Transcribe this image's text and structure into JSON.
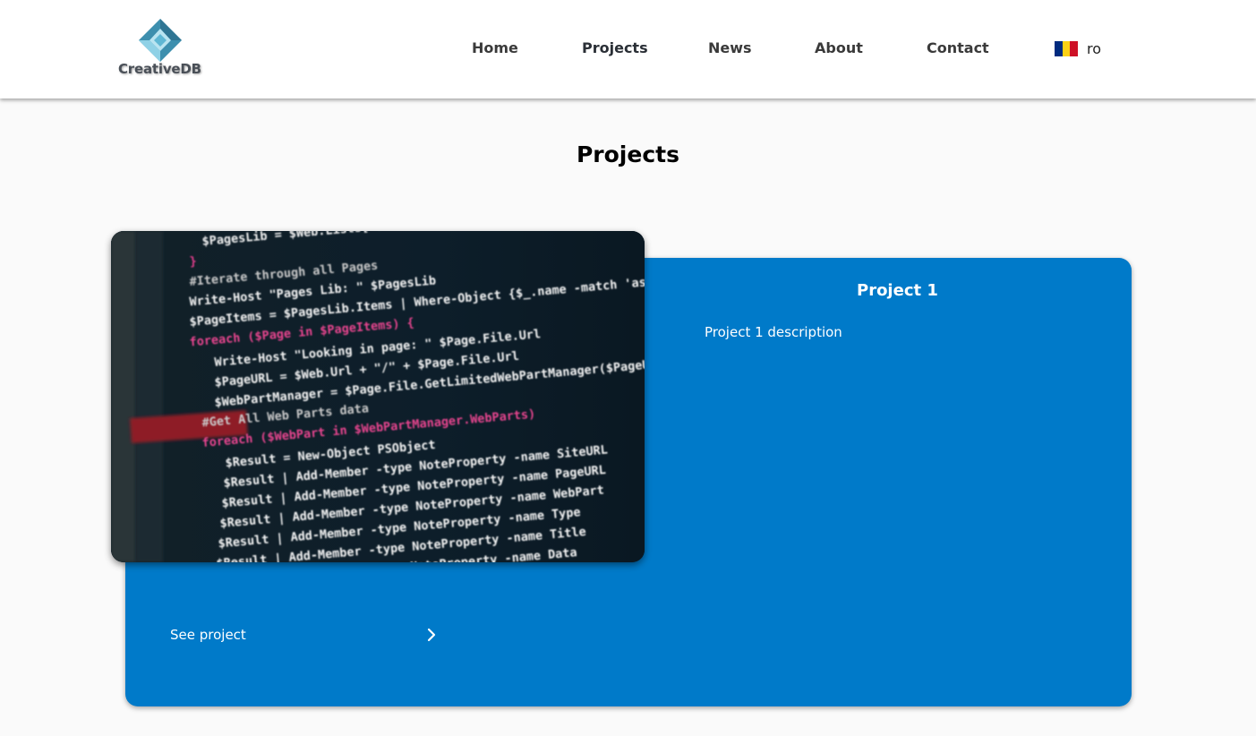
{
  "header": {
    "logo_text": "CreativeDB",
    "nav": [
      {
        "label": "Home"
      },
      {
        "label": "Projects"
      },
      {
        "label": "News"
      },
      {
        "label": "About"
      },
      {
        "label": "Contact"
      }
    ],
    "language": {
      "label": "ro",
      "flag_colors": [
        "#002b7f",
        "#fcd116",
        "#ce1126"
      ]
    }
  },
  "page": {
    "title": "Projects"
  },
  "projects": [
    {
      "title": "Project 1",
      "description": "Project 1 description",
      "link_label": "See project",
      "link_icon": "chevron-right-icon",
      "image_code_lines": [
        "$PagesLib = $Web.Lists[\"Site Pages\"]",
        "}",
        "#Iterate through all Pages",
        "Write-Host \"Pages Lib: \" $PagesLib",
        "$PageItems = $PagesLib.Items | Where-Object {$_.name -match 'aspx'}",
        "foreach ($Page in $PageItems) {",
        "Write-Host \"Looking in page: \" $Page.File.Url",
        "$PageURL = $Web.Url + \"/\" + $Page.File.Url",
        "$WebPartManager = $Page.File.GetLimitedWebPartManager($PageURL)",
        "#Get All Web Parts data",
        "foreach ($WebPart in $WebPartManager.WebParts)",
        "$Result = New-Object PSObject",
        "$Result | Add-Member -type NoteProperty -name SiteURL",
        "$Result | Add-Member -type NoteProperty -name PageURL",
        "$Result | Add-Member -type NoteProperty -name WebPart",
        "$Result | Add-Member -type NoteProperty -name Type",
        "$Result | Add-Member -type NoteProperty -name Title",
        "$Result | Add-Member -type NoteProperty -name Data"
      ]
    }
  ],
  "colors": {
    "card_bg": "#007ac9",
    "header_bg": "#ffffff",
    "page_bg": "#fafafa",
    "logo_accent": "#5fb7d4"
  }
}
